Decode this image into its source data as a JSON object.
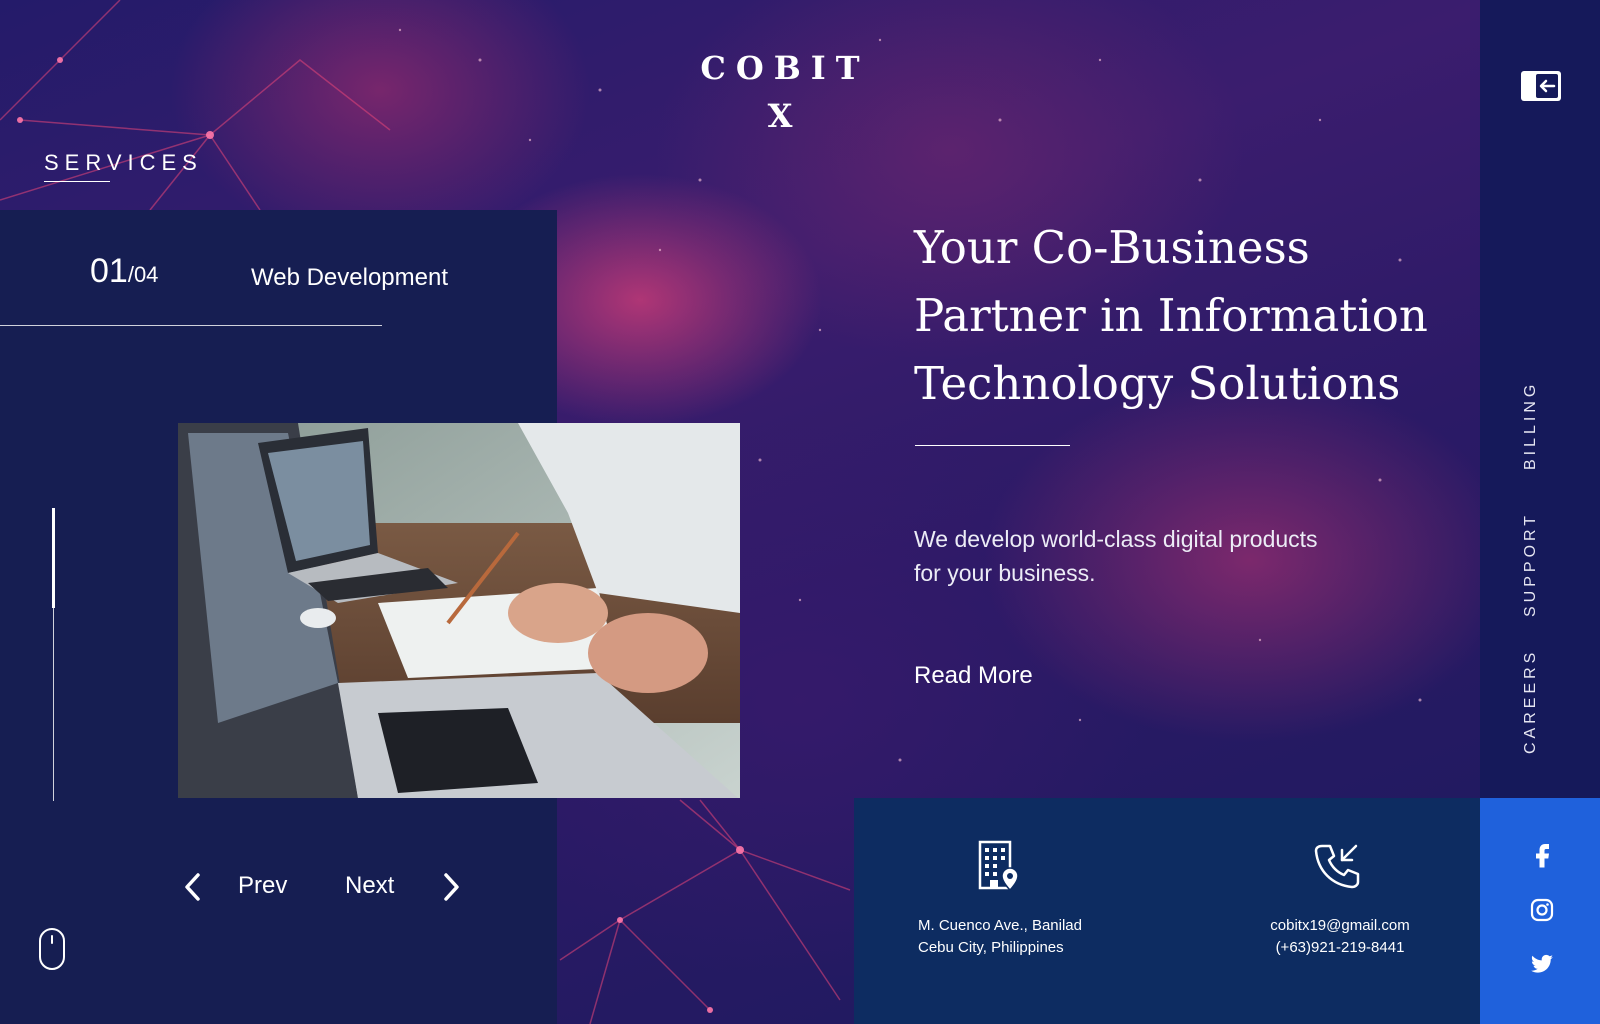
{
  "brand": {
    "logo_line1": "COBIT",
    "logo_line2": "X"
  },
  "section_label": "SERVICES",
  "service": {
    "index": "01",
    "total": "/04",
    "name": "Web Development",
    "image": "laptops-meeting-photo"
  },
  "slider_nav": {
    "prev_label": "Prev",
    "next_label": "Next"
  },
  "hero": {
    "headline_line1": "Your Co-Business",
    "headline_line2": "Partner in Information",
    "headline_line3": "Technology Solutions",
    "tagline_line1": "We develop world-class digital products",
    "tagline_line2": "for your business.",
    "read_more_label": "Read More"
  },
  "side_nav": {
    "items": [
      {
        "label": "BILLING"
      },
      {
        "label": "SUPPORT"
      },
      {
        "label": "CAREERS"
      }
    ]
  },
  "contact": {
    "address_line1": "M. Cuenco Ave., Banilad",
    "address_line2": "Cebu City, Philippines",
    "email": "cobitx19@gmail.com",
    "phone": "(+63)921-219-8441"
  },
  "icons": {
    "exit": "exit-icon",
    "mouse": "mouse-scroll-icon",
    "building": "building-location-icon",
    "phone": "phone-incoming-icon",
    "facebook": "facebook-icon",
    "instagram": "instagram-icon",
    "twitter": "twitter-icon"
  },
  "colors": {
    "panel": "#161e52",
    "contact_box": "#0d2c61",
    "social_box": "#1f61dc",
    "right_bar": "#15195a"
  }
}
